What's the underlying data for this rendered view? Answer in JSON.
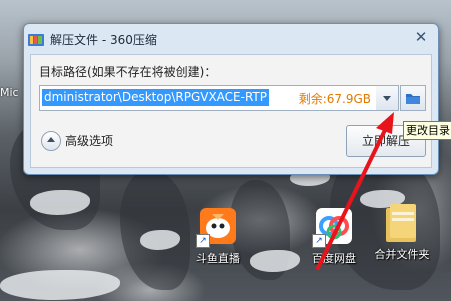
{
  "desktop": {
    "edge_text": "Mic",
    "icons": [
      {
        "label": "斗鱼直播",
        "icon": "douyu-fish-icon"
      },
      {
        "label": "百度网盘",
        "icon": "baidu-netdisk-cloud-icon"
      },
      {
        "label": "合并文件夹",
        "icon": "folder-icon"
      }
    ]
  },
  "dialog": {
    "title": "解压文件 - 360压缩",
    "close_glyph": "✕",
    "path_label": "目标路径(如果不存在将被创建)：",
    "path_value": "dministrator\\Desktop\\RPGVXACE-RTP",
    "free_space": "剩余:67.9GB",
    "advanced_label": "高级选项",
    "extract_button": "立即解压"
  },
  "tooltip": {
    "text": "更改目录"
  },
  "colors": {
    "selection": "#3399ff",
    "free_space": "#e07a00",
    "annotation_arrow": "#e8141c",
    "window_frame": "#dbe7f3"
  }
}
